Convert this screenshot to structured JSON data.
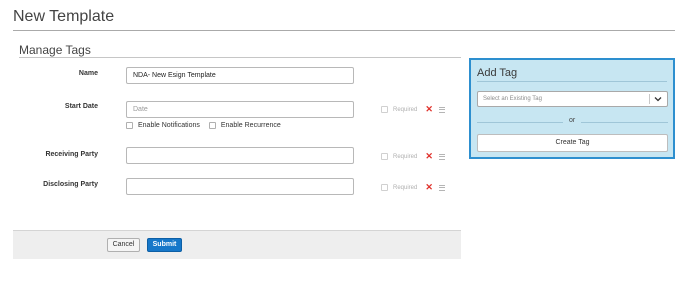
{
  "page": {
    "title": "New Template"
  },
  "manage_tags": {
    "title": "Manage Tags",
    "fields": [
      {
        "label": "Name",
        "value": "NDA- New Esign Template",
        "placeholder": ""
      },
      {
        "label": "Start Date",
        "value": "",
        "placeholder": "Date",
        "required_label": "Required"
      },
      {
        "label": "Receiving Party",
        "value": "",
        "placeholder": "",
        "required_label": "Required"
      },
      {
        "label": "Disclosing Party",
        "value": "",
        "placeholder": "",
        "required_label": "Required"
      }
    ],
    "options": {
      "enable_notifications": "Enable Notifications",
      "enable_recurrence": "Enable Recurrence"
    }
  },
  "footer": {
    "cancel_label": "Cancel",
    "submit_label": "Submit"
  },
  "add_tag": {
    "title": "Add Tag",
    "select_placeholder": "Select an Existing Tag",
    "or_text": "or",
    "create_label": "Create Tag"
  },
  "colors": {
    "accent": "#1677c9",
    "panel_bg": "#c7e6f2",
    "panel_border": "#2d8fcf",
    "remove": "#e0302a"
  },
  "icons": {
    "remove": "x-icon",
    "drag": "drag-handle-icon",
    "dropdown": "chevron-down-icon"
  }
}
